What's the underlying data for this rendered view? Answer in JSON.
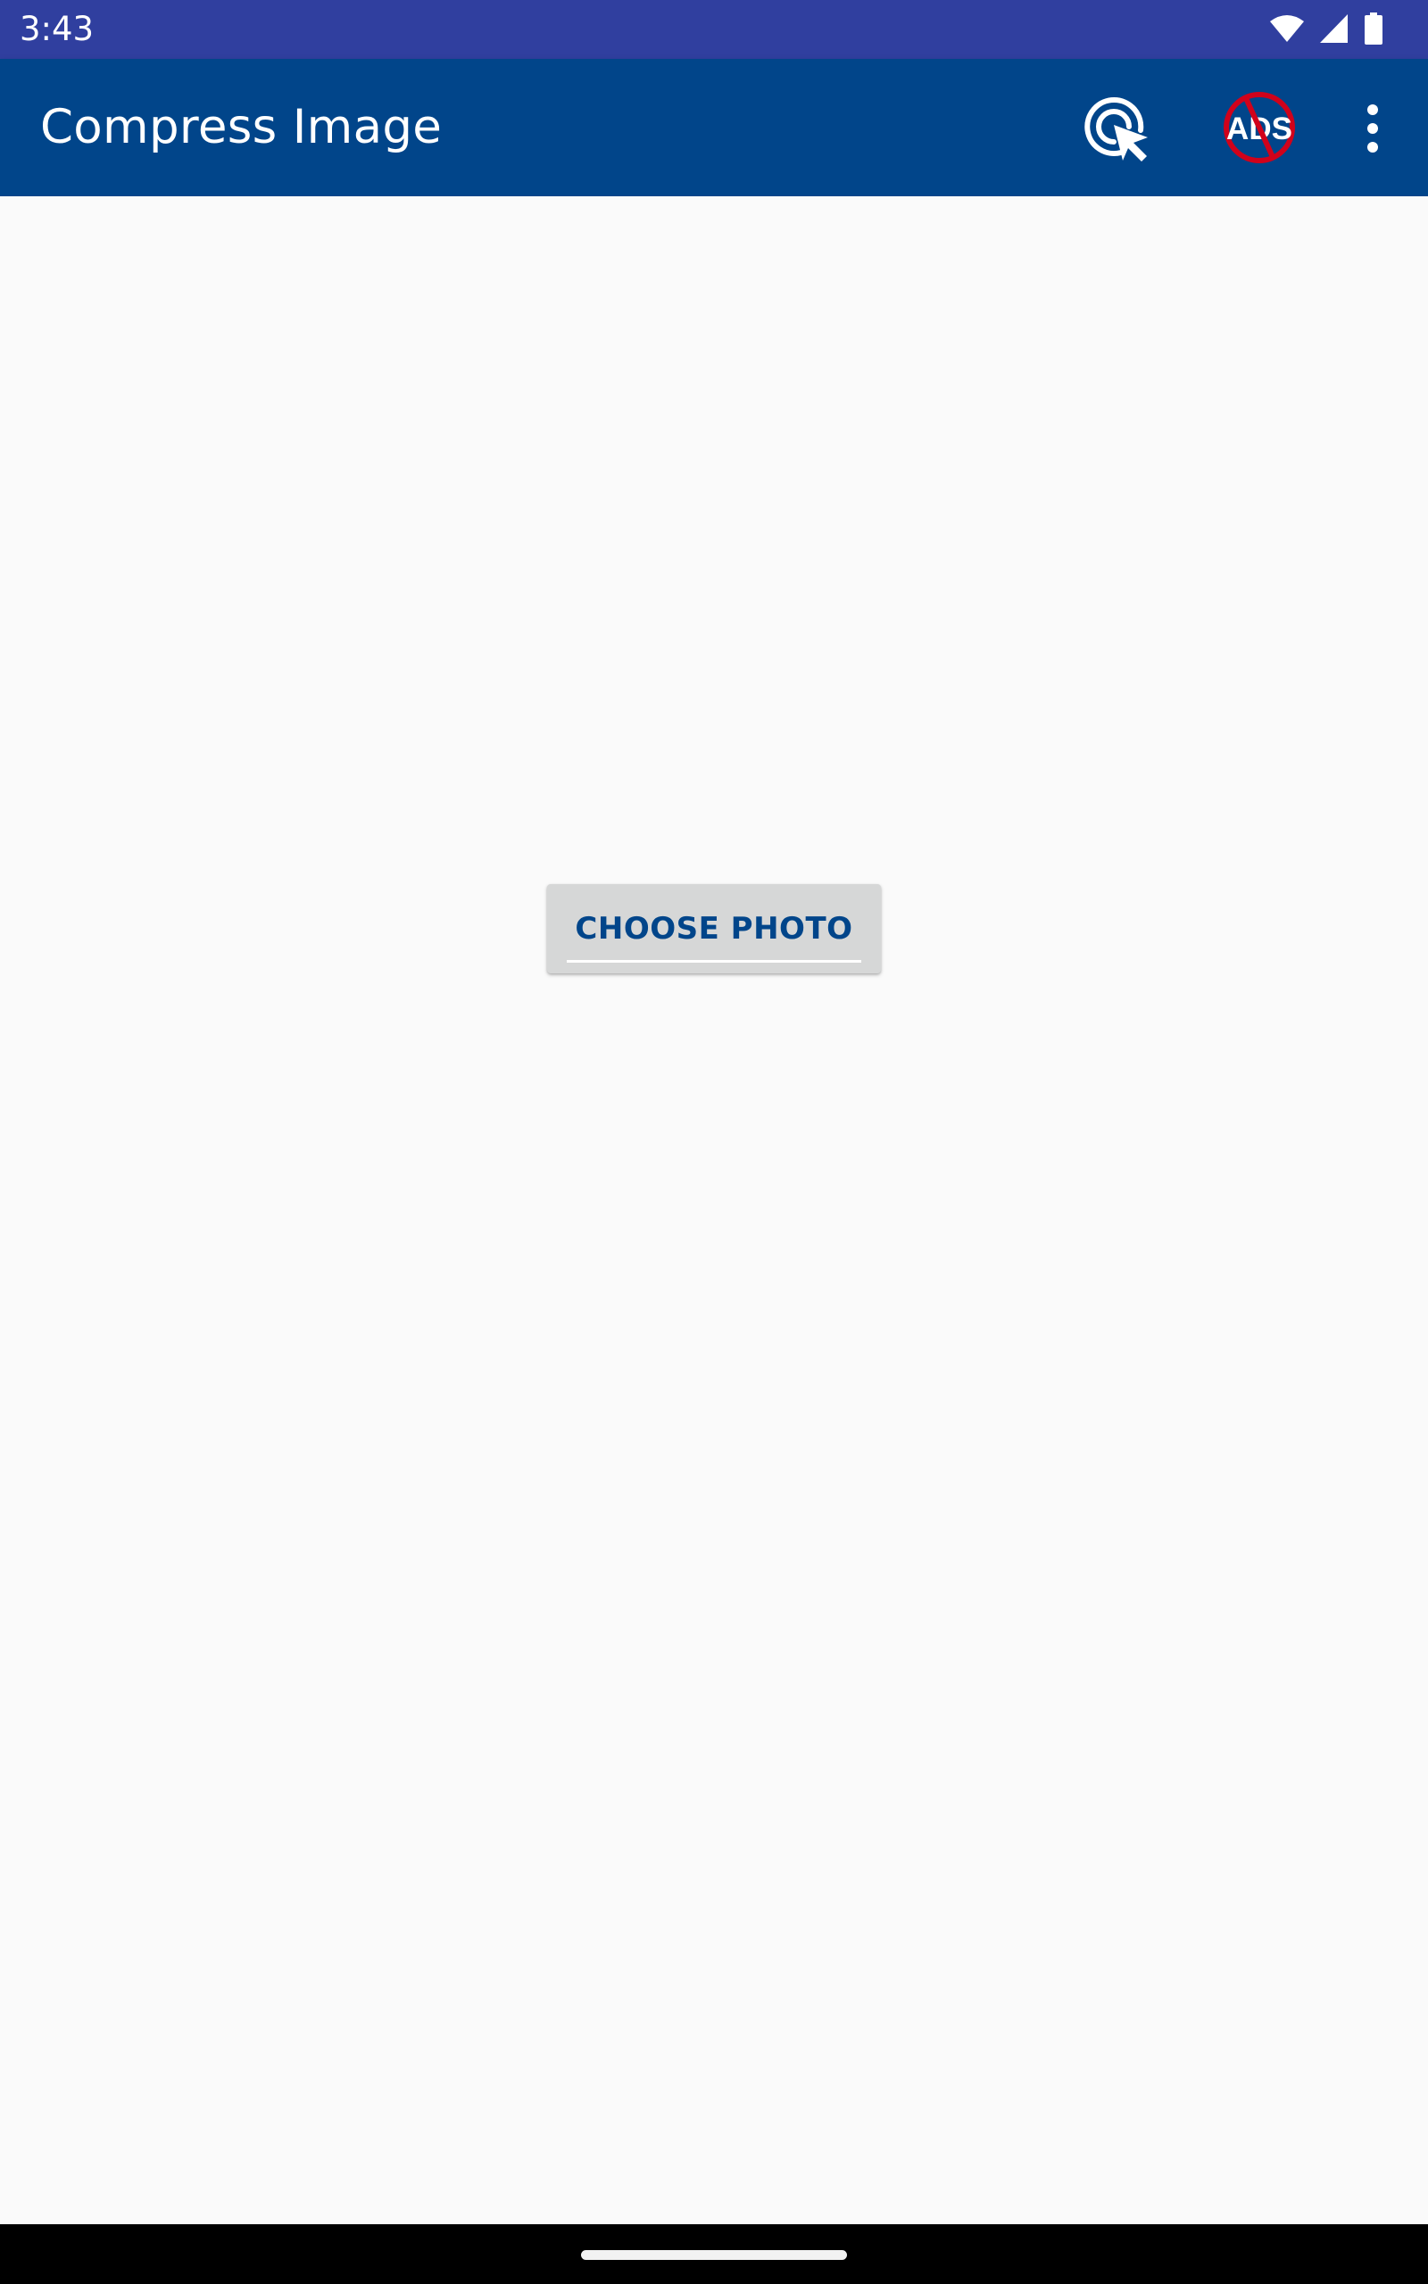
{
  "status_bar": {
    "time": "3:43",
    "icons": [
      "wifi-icon",
      "cellular-signal-icon",
      "battery-icon"
    ]
  },
  "app_bar": {
    "title": "Compress Image",
    "actions": [
      {
        "icon": "touch-select-icon"
      },
      {
        "icon": "no-ads-icon",
        "label": "ADS"
      },
      {
        "icon": "more-vert-icon"
      }
    ]
  },
  "main": {
    "choose_photo_label": "CHOOSE PHOTO"
  },
  "colors": {
    "status_bar": "#303f9f",
    "app_bar": "#01458a",
    "background": "#fafafa",
    "button_bg": "#d6d7d7",
    "button_text": "#01458a",
    "no_ads_red": "#d0021b"
  }
}
